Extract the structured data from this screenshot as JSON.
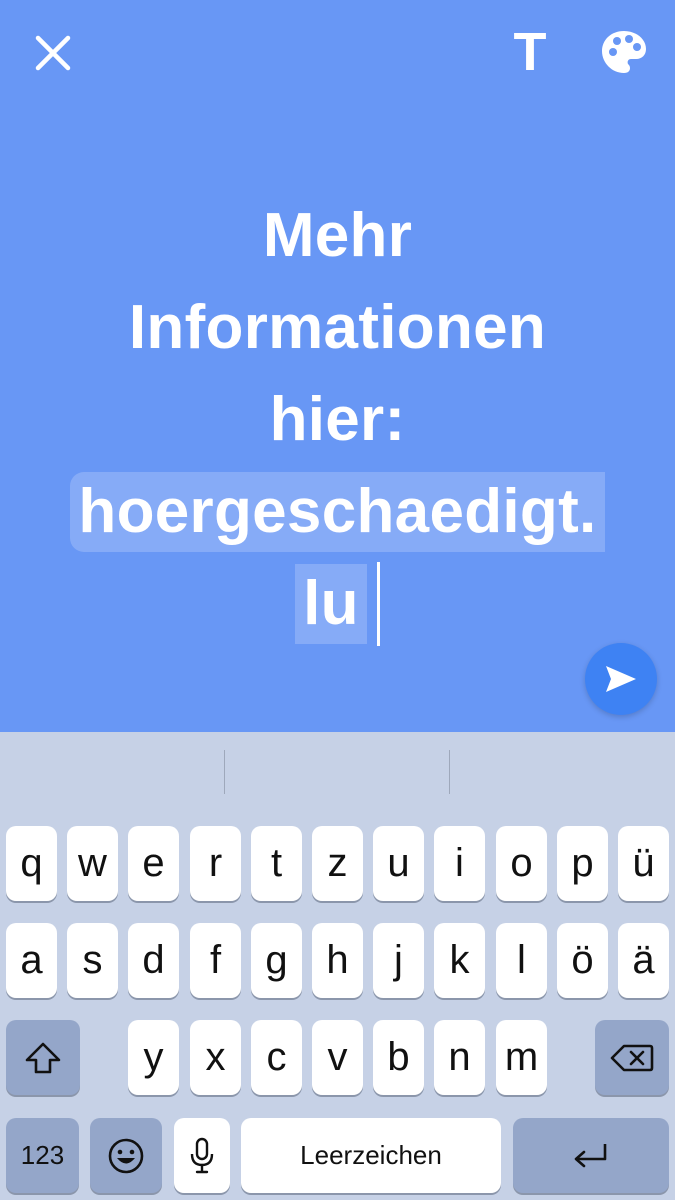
{
  "toolbar": {
    "close_icon": "close-icon",
    "text_button_label": "T",
    "palette_icon": "palette-icon"
  },
  "message": {
    "lines": [
      "Mehr",
      "Informationen",
      "hier:",
      "hoergeschaedigt.",
      "lu"
    ],
    "selected_text": "hoergeschaedigt.lu"
  },
  "send_icon": "send-arrow-icon",
  "keyboard": {
    "predictions": [
      "",
      "",
      ""
    ],
    "row1": [
      "q",
      "w",
      "e",
      "r",
      "t",
      "z",
      "u",
      "i",
      "o",
      "p",
      "ü"
    ],
    "row2": [
      "a",
      "s",
      "d",
      "f",
      "g",
      "h",
      "j",
      "k",
      "l",
      "ö",
      "ä"
    ],
    "row3": [
      "y",
      "x",
      "c",
      "v",
      "b",
      "n",
      "m"
    ],
    "numbers_label": "123",
    "space_label": "Leerzeichen",
    "shift_icon": "shift-icon",
    "delete_icon": "backspace-icon",
    "emoji_icon": "emoji-icon",
    "mic_icon": "microphone-icon",
    "return_icon": "return-icon"
  },
  "colors": {
    "editor_background": "#6897f5",
    "send_button": "#3e82f3",
    "keyboard_background": "#c6d1e6",
    "special_key": "#94a6c9"
  }
}
